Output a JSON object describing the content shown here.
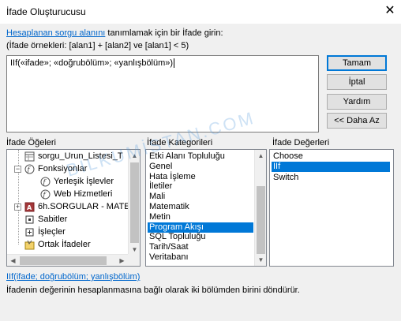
{
  "window": {
    "title": "İfade Oluşturucusu"
  },
  "instructions": {
    "link_text": "Hesaplanan sorgu alanını",
    "text_rest": " tanımlamak için bir İfade girin:",
    "examples": "(İfade örnekleri: [alan1] + [alan2] ve [alan1] < 5)"
  },
  "expression": {
    "value": "IIf(«ifade»; «doğrubölüm»; «yanlışbölüm»)"
  },
  "buttons": {
    "ok": "Tamam",
    "cancel": "İptal",
    "help": "Yardım",
    "less": "<< Daha Az"
  },
  "panels": {
    "elements_label": "İfade Öğeleri",
    "categories_label": "İfade Kategorileri",
    "values_label": "İfade Değerleri"
  },
  "tree": [
    {
      "label": "sorgu_Urun_Listesi_T"
    },
    {
      "label": "Fonksiyonlar"
    },
    {
      "label": "Yerleşik İşlevler"
    },
    {
      "label": "Web Hizmetleri"
    },
    {
      "label": "6h.SORGULAR - MATE"
    },
    {
      "label": "Sabitler"
    },
    {
      "label": "İşleçler"
    },
    {
      "label": "Ortak İfadeler"
    }
  ],
  "categories": [
    "Etki Alanı Topluluğu",
    "Genel",
    "Hata İşleme",
    "İletiler",
    "Mali",
    "Matematik",
    "Metin",
    "Program Akışı",
    "SQL Topluluğu",
    "Tarih/Saat",
    "Veritabanı"
  ],
  "categories_selected": "Program Akışı",
  "values": [
    "Choose",
    "IIf",
    "Switch"
  ],
  "values_selected": "IIf",
  "footer": {
    "syntax": "IIf(ifade; doğrubölüm; yanlışbölüm)",
    "description": "İfadenin değerinin hesaplanmasına bağlı olarak iki bölümden birini döndürür."
  },
  "watermark": "BİLKUMİSTAN.COM",
  "colors": {
    "selection": "#0078d7",
    "link": "#0066cc",
    "dialog_bg": "#f0f0f0"
  }
}
